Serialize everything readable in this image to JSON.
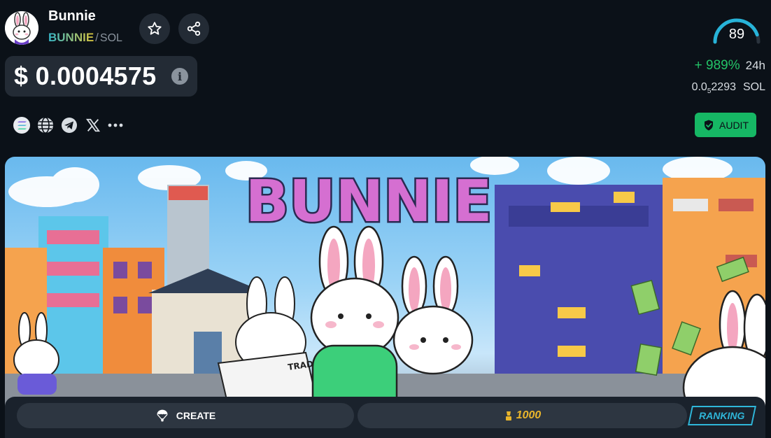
{
  "token": {
    "name": "Bunnie",
    "symbol": "BUNNIE",
    "chain": "SOL",
    "separator": "/"
  },
  "header": {
    "star_icon": "star-icon",
    "share_icon": "share-icon"
  },
  "score": {
    "value": "89",
    "fraction": 0.89,
    "color": "#27b3d8"
  },
  "price": {
    "value": "$ 0.0004575",
    "info_icon": "info-icon"
  },
  "change": {
    "value": "+ 989%",
    "period": "24h",
    "color": "#23c367"
  },
  "sol_price": {
    "prefix": "0.0",
    "zeros": "5",
    "digits": "2293",
    "unit": "SOL"
  },
  "links": [
    "solana-icon",
    "globe-icon",
    "telegram-icon",
    "x-icon",
    "more-icon"
  ],
  "audit": {
    "label": "AUDIT",
    "color": "#16b764"
  },
  "banner": {
    "title": "BUNNIE",
    "newspaper_text": "TRADING"
  },
  "actions": {
    "create_label": "CREATE",
    "vote_value": "1000",
    "ranking_label": "RANKING"
  }
}
